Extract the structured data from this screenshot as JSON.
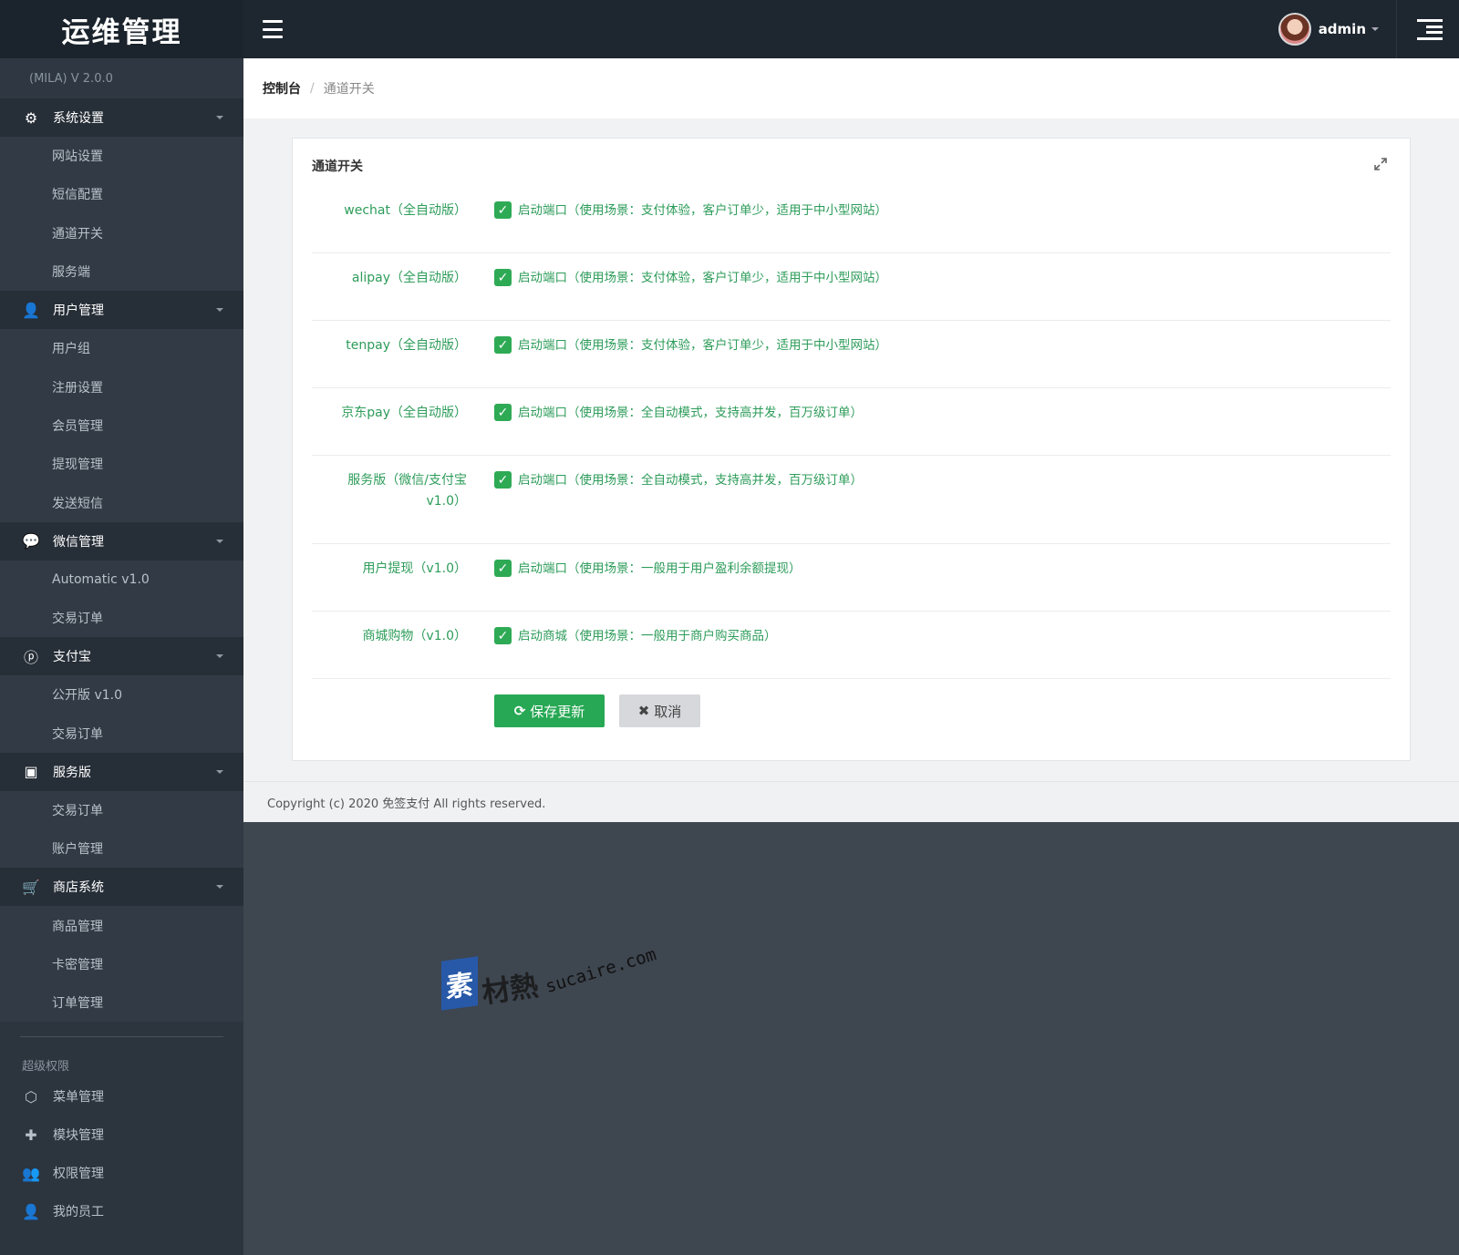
{
  "header": {
    "logo": "运维管理",
    "username": "admin"
  },
  "sidebar": {
    "version": "(MILA)   V 2.0.0",
    "groups": [
      {
        "title": "系统设置",
        "icon": "gear-icon",
        "items": [
          "网站设置",
          "短信配置",
          "通道开关",
          "服务端"
        ]
      },
      {
        "title": "用户管理",
        "icon": "user-icon",
        "items": [
          "用户组",
          "注册设置",
          "会员管理",
          "提现管理",
          "发送短信"
        ]
      },
      {
        "title": "微信管理",
        "icon": "wechat-icon",
        "items": [
          "Automatic v1.0",
          "交易订单"
        ]
      },
      {
        "title": "支付宝",
        "icon": "pinterest-icon",
        "items": [
          "公开版 v1.0",
          "交易订单"
        ]
      },
      {
        "title": "服务版",
        "icon": "server-icon",
        "items": [
          "交易订单",
          "账户管理"
        ]
      },
      {
        "title": "商店系统",
        "icon": "cart-icon",
        "items": [
          "商品管理",
          "卡密管理",
          "订单管理"
        ]
      }
    ],
    "super_label": "超级权限",
    "super_items": [
      {
        "label": "菜单管理",
        "icon": "cube-icon"
      },
      {
        "label": "模块管理",
        "icon": "puzzle-icon"
      },
      {
        "label": "权限管理",
        "icon": "users-icon"
      },
      {
        "label": "我的员工",
        "icon": "staff-icon"
      }
    ]
  },
  "breadcrumb": {
    "home": "控制台",
    "separator": "/",
    "current": "通道开关"
  },
  "panel": {
    "title": "通道开关",
    "rows": [
      {
        "label": "wechat（全自动版）",
        "checked": true,
        "desc": "启动端口（使用场景：支付体验，客户订单少，适用于中小型网站）"
      },
      {
        "label": "alipay（全自动版）",
        "checked": true,
        "desc": "启动端口（使用场景：支付体验，客户订单少，适用于中小型网站）"
      },
      {
        "label": "tenpay（全自动版）",
        "checked": true,
        "desc": "启动端口（使用场景：支付体验，客户订单少，适用于中小型网站）"
      },
      {
        "label": "京东pay（全自动版）",
        "checked": true,
        "desc": "启动端口（使用场景：全自动模式，支持高并发，百万级订单）"
      },
      {
        "label": "服务版（微信/支付宝\nv1.0）",
        "checked": true,
        "desc": "启动端口（使用场景：全自动模式，支持高并发，百万级订单）"
      },
      {
        "label": "用户提现（v1.0）",
        "checked": true,
        "desc": "启动端口（使用场景：一般用于用户盈利余额提现）"
      },
      {
        "label": "商城购物（v1.0）",
        "checked": true,
        "desc": "启动商城（使用场景：一般用于商户购买商品）"
      }
    ],
    "save_label": "保存更新",
    "cancel_label": "取消"
  },
  "footer": {
    "copyright": "Copyright (c) 2020 免签支付 All rights reserved."
  },
  "watermark": {
    "mark": "素",
    "text": "材熱",
    "url": "sucaire.com"
  },
  "colors": {
    "topbar": "#1e2630",
    "sidebar": "#2c343e",
    "accent_green": "#27a854",
    "label_green": "#2d9c5a"
  }
}
